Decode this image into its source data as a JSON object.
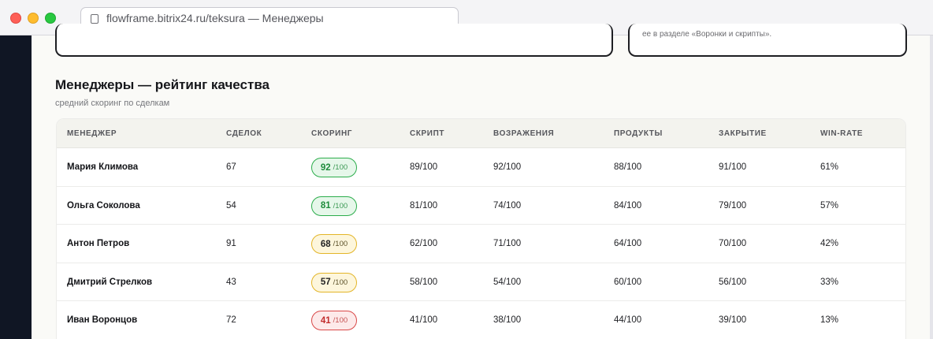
{
  "browser": {
    "url_title": "flowframe.bitrix24.ru/teksura — Менеджеры"
  },
  "top_cards": {
    "right_text": "ее в разделе «Воронки и скрипты»."
  },
  "section": {
    "title": "Менеджеры — рейтинг качества",
    "subtitle": "средний скоринг по сделкам"
  },
  "table": {
    "headers": [
      "МЕНЕДЖЕР",
      "СДЕЛОК",
      "СКОРИНГ",
      "СКРИПТ",
      "ВОЗРАЖЕНИЯ",
      "ПРОДУКТЫ",
      "ЗАКРЫТИЕ",
      "WIN-RATE"
    ],
    "score_suffix": "/100",
    "rows": [
      {
        "name": "Мария Климова",
        "deals": "67",
        "score": "92",
        "score_level": "green",
        "script": "89/100",
        "objections": "92/100",
        "products": "88/100",
        "closing": "91/100",
        "winrate": "61%"
      },
      {
        "name": "Ольга Соколова",
        "deals": "54",
        "score": "81",
        "score_level": "green",
        "script": "81/100",
        "objections": "74/100",
        "products": "84/100",
        "closing": "79/100",
        "winrate": "57%"
      },
      {
        "name": "Антон Петров",
        "deals": "91",
        "score": "68",
        "score_level": "yellow",
        "script": "62/100",
        "objections": "71/100",
        "products": "64/100",
        "closing": "70/100",
        "winrate": "42%"
      },
      {
        "name": "Дмитрий Стрелков",
        "deals": "43",
        "score": "57",
        "score_level": "yellow",
        "script": "58/100",
        "objections": "54/100",
        "products": "60/100",
        "closing": "56/100",
        "winrate": "33%"
      },
      {
        "name": "Иван Воронцов",
        "deals": "72",
        "score": "41",
        "score_level": "red",
        "script": "41/100",
        "objections": "38/100",
        "products": "44/100",
        "closing": "39/100",
        "winrate": "13%"
      }
    ]
  },
  "colors": {
    "sidebar": "#101624",
    "badge_green": "#2cad4c",
    "badge_yellow": "#e3b528",
    "badge_red": "#d94848"
  },
  "icons": {
    "tab_lock": "lock-icon"
  }
}
